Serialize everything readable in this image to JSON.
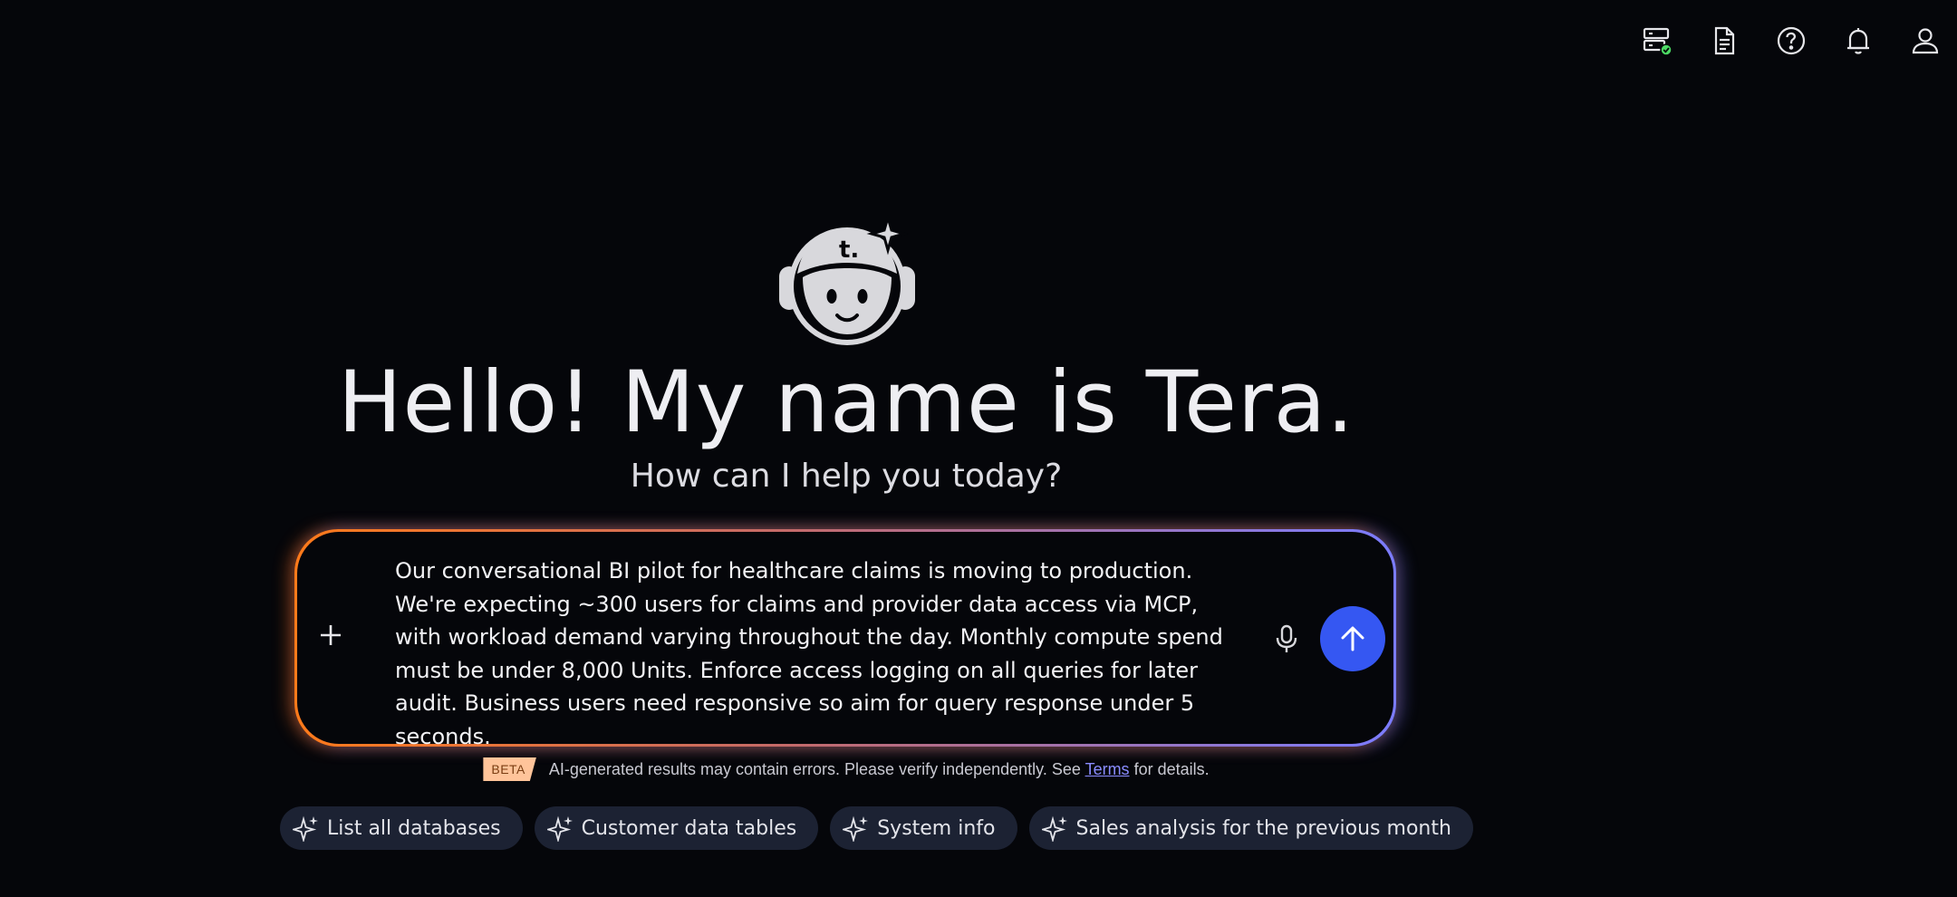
{
  "header": {
    "icons": [
      "server-status-icon",
      "document-icon",
      "help-icon",
      "notifications-icon",
      "profile-icon"
    ],
    "status_color": "#4cd964"
  },
  "hero": {
    "avatar_letter": "t.",
    "greeting": "Hello! My name is Tera.",
    "subtitle": "How can I help you today?"
  },
  "prompt": {
    "value": "Our conversational BI pilot for healthcare claims is moving to production. We're expecting ~300 users for claims and provider data access via MCP, with workload demand varying throughout the day. Monthly compute spend must be under 8,000 Units. Enforce access logging on all queries for later audit. Business users need responsive so aim for query response under 5 seconds."
  },
  "disclaimer": {
    "badge": "BETA",
    "text_before": "AI-generated results may contain errors. Please verify independently. See",
    "link": "Terms",
    "text_after": "for details."
  },
  "suggestions": [
    {
      "label": "List all databases"
    },
    {
      "label": "Customer data tables"
    },
    {
      "label": "System info"
    },
    {
      "label": "Sales analysis for the previous month"
    }
  ],
  "colors": {
    "background": "#05060a",
    "send_button": "#3557f2",
    "chip_background": "#1c2233",
    "gradient_start": "#ff7a1a",
    "gradient_end": "#7b7cff"
  }
}
